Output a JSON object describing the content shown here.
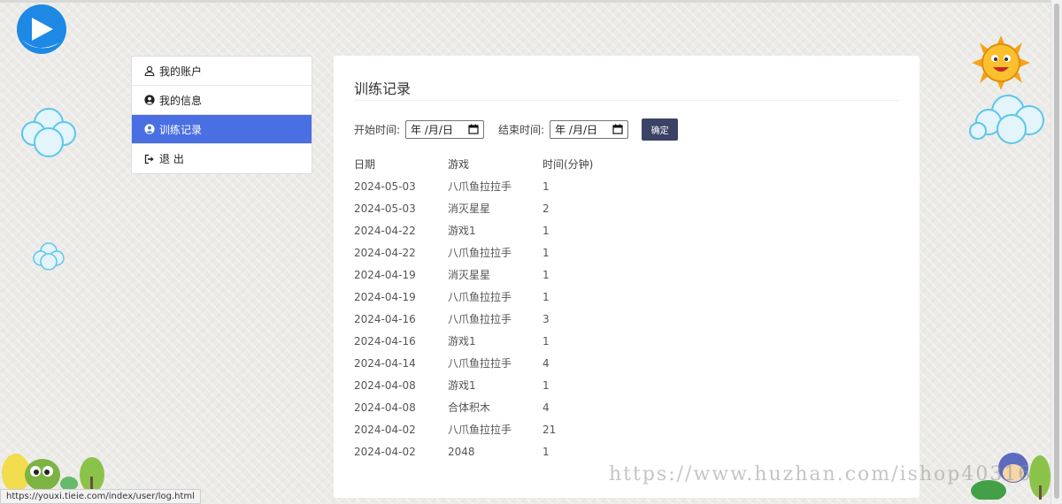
{
  "sidebar": {
    "items": [
      {
        "label": "我的账户",
        "icon": "user-outline-icon",
        "active": false
      },
      {
        "label": "我的信息",
        "icon": "user-circle-icon",
        "active": false
      },
      {
        "label": "训练记录",
        "icon": "user-circle-icon",
        "active": true
      },
      {
        "label": "退 出",
        "icon": "sign-out-icon",
        "active": false
      }
    ]
  },
  "panel": {
    "title": "训练记录",
    "filter": {
      "start_label": "开始时间:",
      "start_value": "年 /月/日",
      "end_label": "结束时间:",
      "end_value": "年 /月/日",
      "confirm_label": "确定"
    },
    "table": {
      "headers": [
        "日期",
        "游戏",
        "时间(分钟)"
      ],
      "rows": [
        [
          "2024-05-03",
          "八爪鱼拉拉手",
          "1"
        ],
        [
          "2024-05-03",
          "消灭星星",
          "2"
        ],
        [
          "2024-04-22",
          "游戏1",
          "1"
        ],
        [
          "2024-04-22",
          "八爪鱼拉拉手",
          "1"
        ],
        [
          "2024-04-19",
          "消灭星星",
          "1"
        ],
        [
          "2024-04-19",
          "八爪鱼拉拉手",
          "1"
        ],
        [
          "2024-04-16",
          "八爪鱼拉拉手",
          "3"
        ],
        [
          "2024-04-16",
          "游戏1",
          "1"
        ],
        [
          "2024-04-14",
          "八爪鱼拉拉手",
          "4"
        ],
        [
          "2024-04-08",
          "游戏1",
          "1"
        ],
        [
          "2024-04-08",
          "合体积木",
          "4"
        ],
        [
          "2024-04-02",
          "八爪鱼拉拉手",
          "21"
        ],
        [
          "2024-04-02",
          "2048",
          "1"
        ]
      ]
    }
  },
  "status_url": "https://youxi.tieie.com/index/user/log.html",
  "watermark": "https://www.huzhan.com/ishop40316",
  "colors": {
    "active": "#4a6fe3",
    "button": "#3a4265",
    "logo": "#1e88e5"
  }
}
